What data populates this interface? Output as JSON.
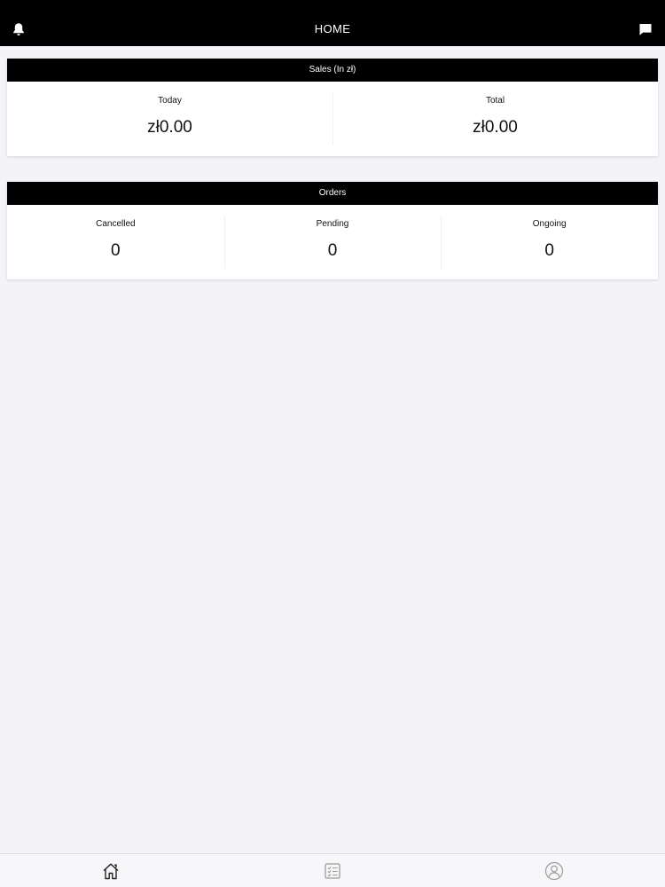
{
  "header": {
    "title": "HOME",
    "left_icon": "bell-icon",
    "right_icon": "chat-icon"
  },
  "sales": {
    "title": "Sales (In zł)",
    "today_label": "Today",
    "today_value": "zł0.00",
    "total_label": "Total",
    "total_value": "zł0.00"
  },
  "orders": {
    "title": "Orders",
    "cancelled_label": "Cancelled",
    "cancelled_value": "0",
    "pending_label": "Pending",
    "pending_value": "0",
    "ongoing_label": "Ongoing",
    "ongoing_value": "0"
  },
  "bottom_nav": {
    "items": [
      {
        "icon": "home-icon",
        "active": true
      },
      {
        "icon": "checklist-icon",
        "active": false
      },
      {
        "icon": "profile-icon",
        "active": false
      }
    ]
  },
  "colors": {
    "header_bg": "#000000",
    "page_bg": "#f4f3f7",
    "card_bg": "#ffffff",
    "inactive_icon": "#9b9b9b"
  }
}
